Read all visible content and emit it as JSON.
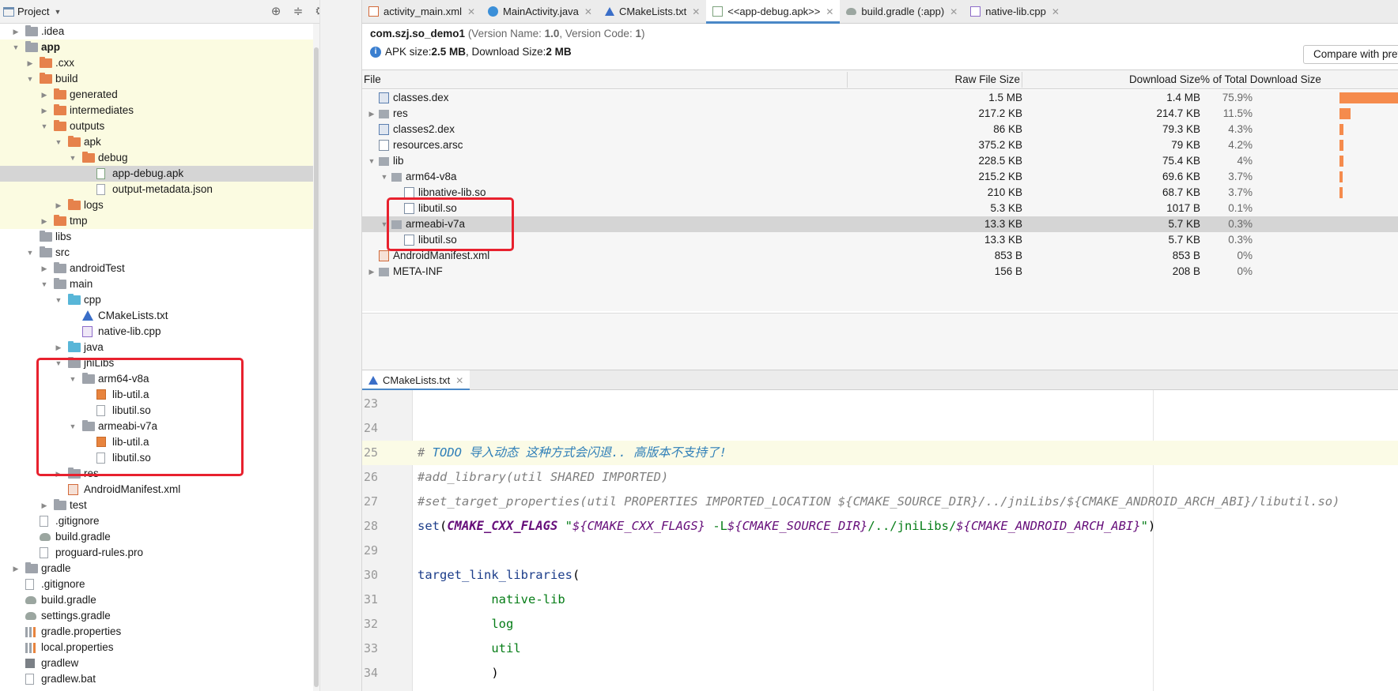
{
  "project_panel": {
    "title": "Project",
    "tree": [
      {
        "label": ".idea",
        "depth": 1,
        "arrow": "right",
        "icon": "folder-grey",
        "hl": false
      },
      {
        "label": "app",
        "depth": 1,
        "arrow": "down",
        "icon": "folder-grey",
        "bold": true,
        "hl": true
      },
      {
        "label": ".cxx",
        "depth": 2,
        "arrow": "right",
        "icon": "folder-orange",
        "hl": true
      },
      {
        "label": "build",
        "depth": 2,
        "arrow": "down",
        "icon": "folder-orange",
        "hl": true
      },
      {
        "label": "generated",
        "depth": 3,
        "arrow": "right",
        "icon": "folder-orange",
        "hl": true
      },
      {
        "label": "intermediates",
        "depth": 3,
        "arrow": "right",
        "icon": "folder-orange",
        "hl": true
      },
      {
        "label": "outputs",
        "depth": 3,
        "arrow": "down",
        "icon": "folder-orange",
        "hl": true
      },
      {
        "label": "apk",
        "depth": 4,
        "arrow": "down",
        "icon": "folder-orange",
        "hl": true
      },
      {
        "label": "debug",
        "depth": 5,
        "arrow": "down",
        "icon": "folder-orange",
        "hl": true
      },
      {
        "label": "app-debug.apk",
        "depth": 6,
        "arrow": "",
        "icon": "file-apk",
        "sel": true
      },
      {
        "label": "output-metadata.json",
        "depth": 6,
        "arrow": "",
        "icon": "file-ico",
        "hl": true
      },
      {
        "label": "logs",
        "depth": 4,
        "arrow": "right",
        "icon": "folder-orange",
        "hl": true
      },
      {
        "label": "tmp",
        "depth": 3,
        "arrow": "right",
        "icon": "folder-orange",
        "hl": true
      },
      {
        "label": "libs",
        "depth": 2,
        "arrow": "",
        "icon": "folder-grey"
      },
      {
        "label": "src",
        "depth": 2,
        "arrow": "down",
        "icon": "folder-grey"
      },
      {
        "label": "androidTest",
        "depth": 3,
        "arrow": "right",
        "icon": "folder-grey"
      },
      {
        "label": "main",
        "depth": 3,
        "arrow": "down",
        "icon": "folder-grey"
      },
      {
        "label": "cpp",
        "depth": 4,
        "arrow": "down",
        "icon": "folder-blue"
      },
      {
        "label": "CMakeLists.txt",
        "depth": 5,
        "arrow": "",
        "icon": "file-cmake"
      },
      {
        "label": "native-lib.cpp",
        "depth": 5,
        "arrow": "",
        "icon": "file-cpp"
      },
      {
        "label": "java",
        "depth": 4,
        "arrow": "right",
        "icon": "folder-blue"
      },
      {
        "label": "jniLibs",
        "depth": 4,
        "arrow": "down",
        "icon": "folder-grey"
      },
      {
        "label": "arm64-v8a",
        "depth": 5,
        "arrow": "down",
        "icon": "folder-grey"
      },
      {
        "label": "lib-util.a",
        "depth": 6,
        "arrow": "",
        "icon": "file-lib"
      },
      {
        "label": "libutil.so",
        "depth": 6,
        "arrow": "",
        "icon": "file-ico"
      },
      {
        "label": "armeabi-v7a",
        "depth": 5,
        "arrow": "down",
        "icon": "folder-grey"
      },
      {
        "label": "lib-util.a",
        "depth": 6,
        "arrow": "",
        "icon": "file-lib"
      },
      {
        "label": "libutil.so",
        "depth": 6,
        "arrow": "",
        "icon": "file-ico"
      },
      {
        "label": "res",
        "depth": 4,
        "arrow": "right",
        "icon": "folder-grey"
      },
      {
        "label": "AndroidManifest.xml",
        "depth": 4,
        "arrow": "",
        "icon": "file-xml"
      },
      {
        "label": "test",
        "depth": 3,
        "arrow": "right",
        "icon": "folder-grey"
      },
      {
        "label": ".gitignore",
        "depth": 2,
        "arrow": "",
        "icon": "file-ico"
      },
      {
        "label": "build.gradle",
        "depth": 2,
        "arrow": "",
        "icon": "file-gradle"
      },
      {
        "label": "proguard-rules.pro",
        "depth": 2,
        "arrow": "",
        "icon": "file-ico"
      },
      {
        "label": "gradle",
        "depth": 1,
        "arrow": "right",
        "icon": "folder-grey"
      },
      {
        "label": ".gitignore",
        "depth": 1,
        "arrow": "",
        "icon": "file-ico"
      },
      {
        "label": "build.gradle",
        "depth": 1,
        "arrow": "",
        "icon": "file-gradle"
      },
      {
        "label": "settings.gradle",
        "depth": 1,
        "arrow": "",
        "icon": "file-gradle"
      },
      {
        "label": "gradle.properties",
        "depth": 1,
        "arrow": "",
        "icon": "file-bars"
      },
      {
        "label": "local.properties",
        "depth": 1,
        "arrow": "",
        "icon": "file-bars"
      },
      {
        "label": "gradlew",
        "depth": 1,
        "arrow": "",
        "icon": "file-term"
      },
      {
        "label": "gradlew.bat",
        "depth": 1,
        "arrow": "",
        "icon": "file-ico"
      }
    ]
  },
  "editor_tabs": [
    {
      "label": "activity_main.xml",
      "icon": "xml-file-icon",
      "color": "#d36a3a"
    },
    {
      "label": "MainActivity.java",
      "icon": "java-class-icon",
      "color": "#3b8fd8"
    },
    {
      "label": "CMakeLists.txt",
      "icon": "cmake-icon",
      "color": "#3a6ec8"
    },
    {
      "label": "<<app-debug.apk>>",
      "icon": "apk-icon",
      "color": "#7da37d",
      "active": true
    },
    {
      "label": "build.gradle (:app)",
      "icon": "gradle-icon",
      "color": "#9ba6a0"
    },
    {
      "label": "native-lib.cpp",
      "icon": "cpp-file-icon",
      "color": "#8e6cc9"
    }
  ],
  "apk": {
    "package": "com.szj.so_demo1",
    "version_prefix": "(Version Name: ",
    "version_name": "1.0",
    "version_mid": ", Version Code: ",
    "version_code": "1",
    "version_suffix": ")",
    "size_prefix": "APK size: ",
    "apk_size": "2.5 MB",
    "size_mid": ", Download Size: ",
    "download_size": "2 MB",
    "compare_button": "Compare with previous APK..."
  },
  "table": {
    "columns": [
      "File",
      "Raw File Size",
      "Download Size",
      "% of Total Download Size"
    ],
    "rows": [
      {
        "name": "classes.dex",
        "depth": 0,
        "arrow": "",
        "icon": "dex",
        "raw": "1.5 MB",
        "dl": "1.4 MB",
        "pct": "75.9%",
        "share": 0.759
      },
      {
        "name": "res",
        "depth": 0,
        "arrow": "right",
        "icon": "folder",
        "raw": "217.2 KB",
        "dl": "214.7 KB",
        "pct": "11.5%",
        "share": 0.115
      },
      {
        "name": "classes2.dex",
        "depth": 0,
        "arrow": "",
        "icon": "dex",
        "raw": "86 KB",
        "dl": "79.3 KB",
        "pct": "4.3%",
        "share": 0.043
      },
      {
        "name": "resources.arsc",
        "depth": 0,
        "arrow": "",
        "icon": "so",
        "raw": "375.2 KB",
        "dl": "79 KB",
        "pct": "4.2%",
        "share": 0.042
      },
      {
        "name": "lib",
        "depth": 0,
        "arrow": "down",
        "icon": "folder",
        "raw": "228.5 KB",
        "dl": "75.4 KB",
        "pct": "4%",
        "share": 0.04
      },
      {
        "name": "arm64-v8a",
        "depth": 1,
        "arrow": "down",
        "icon": "folder",
        "raw": "215.2 KB",
        "dl": "69.6 KB",
        "pct": "3.7%",
        "share": 0.037
      },
      {
        "name": "libnative-lib.so",
        "depth": 2,
        "arrow": "",
        "icon": "so",
        "raw": "210 KB",
        "dl": "68.7 KB",
        "pct": "3.7%",
        "share": 0.037
      },
      {
        "name": "libutil.so",
        "depth": 2,
        "arrow": "",
        "icon": "so",
        "raw": "5.3 KB",
        "dl": "1017 B",
        "pct": "0.1%",
        "share": 0.0
      },
      {
        "name": "armeabi-v7a",
        "depth": 1,
        "arrow": "down",
        "icon": "folder",
        "raw": "13.3 KB",
        "dl": "5.7 KB",
        "pct": "0.3%",
        "share": 0.0,
        "sel": true
      },
      {
        "name": "libutil.so",
        "depth": 2,
        "arrow": "",
        "icon": "so",
        "raw": "13.3 KB",
        "dl": "5.7 KB",
        "pct": "0.3%",
        "share": 0.0
      },
      {
        "name": "AndroidManifest.xml",
        "depth": 0,
        "arrow": "",
        "icon": "xml",
        "raw": "853 B",
        "dl": "853 B",
        "pct": "0%",
        "share": 0.0
      },
      {
        "name": "META-INF",
        "depth": 0,
        "arrow": "right",
        "icon": "folder",
        "raw": "156 B",
        "dl": "208 B",
        "pct": "0%",
        "share": 0.0
      }
    ]
  },
  "code_tab": {
    "label": "CMakeLists.txt",
    "icon": "cmake-icon"
  },
  "code": {
    "lines": [
      {
        "n": "23",
        "parts": []
      },
      {
        "n": "24",
        "parts": []
      },
      {
        "n": "25",
        "current": true,
        "parts": [
          [
            "c-cmt",
            "# "
          ],
          [
            "c-todo",
            "TODO 导入动态 这种方式会闪退.. 高版本不支持了!"
          ]
        ]
      },
      {
        "n": "26",
        "parts": [
          [
            "c-cmt",
            "#add_library(util SHARED IMPORTED)"
          ]
        ]
      },
      {
        "n": "27",
        "parts": [
          [
            "c-cmt",
            "#set_target_properties(util PROPERTIES IMPORTED_LOCATION ${CMAKE_SOURCE_DIR}/../jniLibs/${CMAKE_ANDROID_ARCH_ABI}/libutil.so)"
          ]
        ]
      },
      {
        "n": "28",
        "parts": [
          [
            "c-fn",
            "set"
          ],
          [
            "c-plain",
            "("
          ],
          [
            "c-var",
            "CMAKE_CXX_FLAGS"
          ],
          [
            "c-plain",
            " "
          ],
          [
            "c-str",
            "\""
          ],
          [
            "c-strv",
            "${CMAKE_CXX_FLAGS}"
          ],
          [
            "c-str",
            " -L"
          ],
          [
            "c-strv",
            "${CMAKE_SOURCE_DIR}"
          ],
          [
            "c-str",
            "/../jniLibs/"
          ],
          [
            "c-strv",
            "${CMAKE_ANDROID_ARCH_ABI}"
          ],
          [
            "c-str",
            "\""
          ],
          [
            "c-plain",
            ")"
          ]
        ]
      },
      {
        "n": "29",
        "parts": []
      },
      {
        "n": "30",
        "parts": [
          [
            "c-fn",
            "target_link_libraries"
          ],
          [
            "c-plain",
            "("
          ]
        ]
      },
      {
        "n": "31",
        "parts": [
          [
            "c-plain",
            "          "
          ],
          [
            "c-arg",
            "native-lib"
          ]
        ]
      },
      {
        "n": "32",
        "parts": [
          [
            "c-plain",
            "          "
          ],
          [
            "c-arg",
            "log"
          ]
        ]
      },
      {
        "n": "33",
        "parts": [
          [
            "c-plain",
            "          "
          ],
          [
            "c-arg",
            "util"
          ]
        ]
      },
      {
        "n": "34",
        "parts": [
          [
            "c-plain",
            "          )"
          ]
        ]
      }
    ]
  },
  "colors": {
    "accent": "#4a88c7",
    "bar": "#f58b4d",
    "highlight_box": "#e8212e"
  }
}
